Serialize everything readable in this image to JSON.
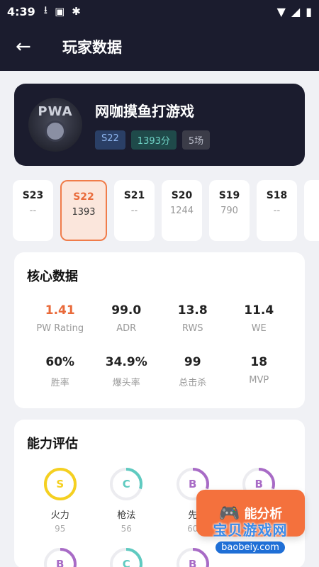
{
  "status_bar": {
    "time": "4:39"
  },
  "header": {
    "title": "玩家数据"
  },
  "profile": {
    "avatar_text": "PWA",
    "name": "网咖摸鱼打游戏",
    "season_badge": "S22",
    "score_badge": "1393分",
    "matches_badge": "5场"
  },
  "seasons": [
    {
      "name": "S23",
      "value": "--"
    },
    {
      "name": "S22",
      "value": "1393"
    },
    {
      "name": "S21",
      "value": "--"
    },
    {
      "name": "S20",
      "value": "1244"
    },
    {
      "name": "S19",
      "value": "790"
    },
    {
      "name": "S18",
      "value": "--"
    }
  ],
  "core": {
    "title": "核心数据",
    "stats": [
      {
        "value": "1.41",
        "label": "PW Rating"
      },
      {
        "value": "99.0",
        "label": "ADR"
      },
      {
        "value": "13.8",
        "label": "RWS"
      },
      {
        "value": "11.4",
        "label": "WE"
      },
      {
        "value": "60%",
        "label": "胜率"
      },
      {
        "value": "34.9%",
        "label": "爆头率"
      },
      {
        "value": "99",
        "label": "总击杀"
      },
      {
        "value": "18",
        "label": "MVP"
      }
    ]
  },
  "ability": {
    "title": "能力评估",
    "items": [
      {
        "grade": "S",
        "label": "火力",
        "value": "95",
        "color": "#f5d020",
        "fraction": 1.0
      },
      {
        "grade": "C",
        "label": "枪法",
        "value": "56",
        "color": "#5fcac0",
        "fraction": 0.3
      },
      {
        "grade": "B",
        "label": "先",
        "value": "60",
        "color": "#a86bc6",
        "fraction": 0.3
      },
      {
        "grade": "B",
        "label": "",
        "value": "",
        "color": "#a86bc6",
        "fraction": 0.3
      },
      {
        "grade": "B",
        "label": "",
        "value": "",
        "color": "#a86bc6",
        "fraction": 0.3
      },
      {
        "grade": "C",
        "label": "",
        "value": "",
        "color": "#5fcac0",
        "fraction": 0.3
      },
      {
        "grade": "B",
        "label": "",
        "value": "",
        "color": "#a86bc6",
        "fraction": 0.3
      }
    ]
  },
  "fab": {
    "label": "能分析"
  },
  "watermark": {
    "text": "宝贝游戏网",
    "url": "baobeiy.com"
  }
}
